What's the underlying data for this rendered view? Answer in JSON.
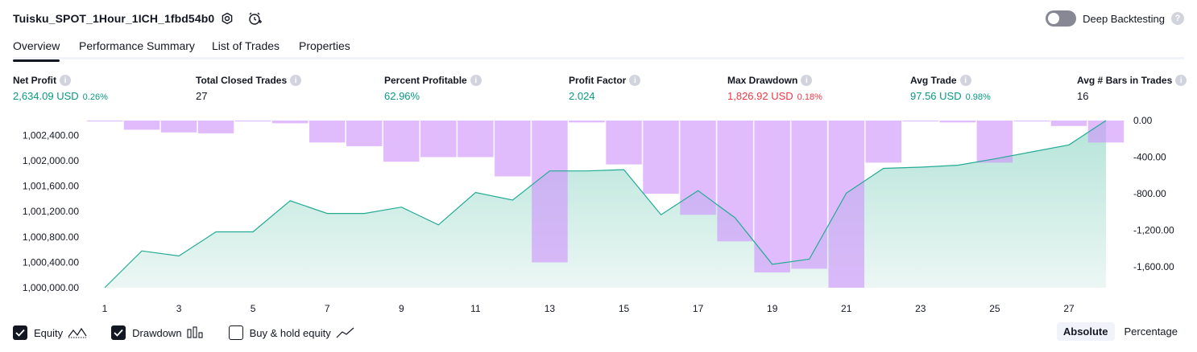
{
  "header": {
    "strategy_name": "Tuisku_SPOT_1Hour_1ICH_1fbd54b0",
    "deep_backtesting_label": "Deep Backtesting",
    "deep_backtesting_on": false,
    "help_glyph": "?",
    "icons": [
      "settings-icon",
      "alert-add-icon",
      "toggle-switch",
      "help-icon"
    ]
  },
  "tabs": [
    {
      "label": "Overview",
      "active": true
    },
    {
      "label": "Performance Summary",
      "active": false
    },
    {
      "label": "List of Trades",
      "active": false
    },
    {
      "label": "Properties",
      "active": false
    }
  ],
  "metrics": [
    {
      "label": "Net Profit",
      "value": "2,634.09 USD",
      "pct": "0.26%",
      "tone": "pos"
    },
    {
      "label": "Total Closed Trades",
      "value": "27",
      "pct": "",
      "tone": "neutral"
    },
    {
      "label": "Percent Profitable",
      "value": "62.96%",
      "pct": "",
      "tone": "pos"
    },
    {
      "label": "Profit Factor",
      "value": "2.024",
      "pct": "",
      "tone": "pos"
    },
    {
      "label": "Max Drawdown",
      "value": "1,826.92 USD",
      "pct": "0.18%",
      "tone": "neg"
    },
    {
      "label": "Avg Trade",
      "value": "97.56 USD",
      "pct": "0.98%",
      "tone": "pos"
    },
    {
      "label": "Avg # Bars in Trades",
      "value": "16",
      "pct": "",
      "tone": "neutral"
    }
  ],
  "colors": {
    "equity_line": "#22ab94",
    "equity_fill_top": "#a8dfd2",
    "equity_fill_bottom": "#eaf6f3",
    "drawdown_bar": "#ce93fb",
    "positive": "#089981",
    "negative": "#f23645"
  },
  "chart_data": {
    "type": "line",
    "left_axis": {
      "ticks": [
        1000000,
        1000400,
        1000800,
        1001200,
        1001600,
        1002000,
        1002400
      ],
      "tick_labels": [
        "1,000,000.00",
        "1,000,400.00",
        "1,000,800.00",
        "1,001,200.00",
        "1,001,600.00",
        "1,002,000.00",
        "1,002,400.00"
      ],
      "ylim": [
        1000000,
        1002634
      ]
    },
    "right_axis": {
      "ticks": [
        0,
        -400,
        -800,
        -1200,
        -1600
      ],
      "tick_labels": [
        "0.00",
        "-400.00",
        "-800.00",
        "-1,200.00",
        "-1,600.00"
      ],
      "ylim": [
        -1826.92,
        0
      ]
    },
    "x_ticks": [
      1,
      3,
      5,
      7,
      9,
      11,
      13,
      15,
      17,
      19,
      21,
      23,
      25,
      27
    ],
    "x_tick_labels": [
      "1",
      "3",
      "5",
      "7",
      "9",
      "11",
      "13",
      "15",
      "17",
      "19",
      "21",
      "23",
      "25",
      "27"
    ],
    "series": [
      {
        "name": "Equity",
        "x": [
          1,
          2,
          3,
          4,
          5,
          6,
          7,
          8,
          9,
          10,
          11,
          12,
          13,
          14,
          15,
          16,
          17,
          18,
          19,
          20,
          21,
          22,
          23,
          24,
          25,
          26,
          27,
          28
        ],
        "values": [
          1000000,
          1000580,
          1000500,
          1000880,
          1000880,
          1001370,
          1001170,
          1001170,
          1001270,
          1000990,
          1001500,
          1001380,
          1001840,
          1001840,
          1001860,
          1001150,
          1001530,
          1001100,
          1000370,
          1000450,
          1001490,
          1001880,
          1001900,
          1001930,
          1002030,
          1002140,
          1002250,
          1002634
        ]
      },
      {
        "name": "Drawdown",
        "x": [
          1,
          2,
          3,
          4,
          5,
          6,
          7,
          8,
          9,
          10,
          11,
          12,
          13,
          14,
          15,
          16,
          17,
          18,
          19,
          20,
          21,
          22,
          23,
          24,
          25,
          26,
          27,
          28
        ],
        "values": [
          -10,
          -100,
          -130,
          -140,
          -10,
          -30,
          -240,
          -280,
          -450,
          -400,
          -400,
          -610,
          -1550,
          -20,
          -480,
          -800,
          -1030,
          -1320,
          -1660,
          -1620,
          -1826.92,
          -460,
          -10,
          -20,
          -460,
          -10,
          -60,
          -240
        ]
      }
    ]
  },
  "legend": [
    {
      "label": "Equity",
      "checked": true
    },
    {
      "label": "Drawdown",
      "checked": true
    },
    {
      "label": "Buy & hold equity",
      "checked": false
    }
  ],
  "mode_switch": {
    "absolute": "Absolute",
    "percentage": "Percentage",
    "active": "absolute"
  }
}
